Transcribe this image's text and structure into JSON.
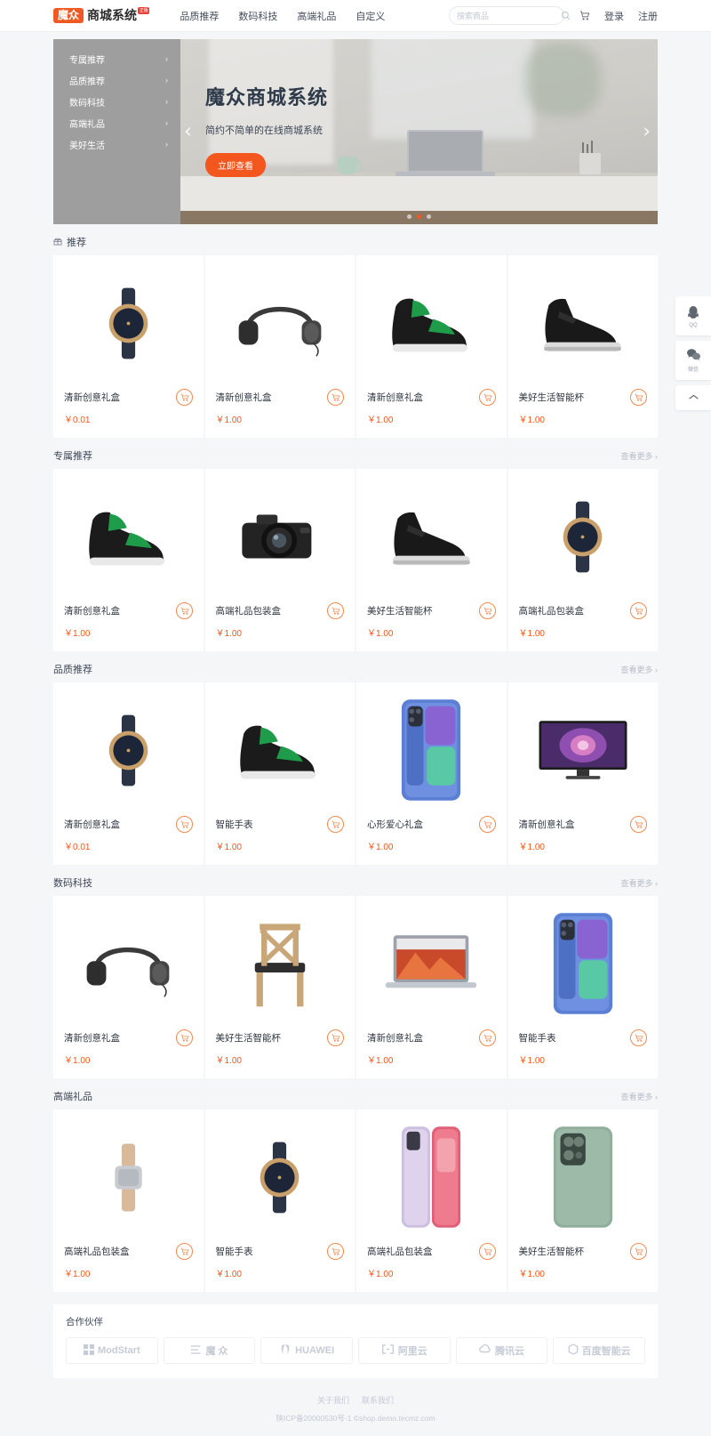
{
  "header": {
    "logo_badge": "魔众",
    "logo_text": "商城系统",
    "logo_tag": "正版",
    "nav": [
      {
        "label": "品质推荐"
      },
      {
        "label": "数码科技"
      },
      {
        "label": "高端礼品"
      },
      {
        "label": "自定义"
      }
    ],
    "search_placeholder": "搜索商品",
    "search_value": "",
    "search_icon": "search-icon",
    "cart_icon": "cart-icon",
    "login": "登录",
    "register": "注册"
  },
  "banner": {
    "categories": [
      {
        "label": "专属推荐"
      },
      {
        "label": "品质推荐"
      },
      {
        "label": "数码科技"
      },
      {
        "label": "高端礼品"
      },
      {
        "label": "美好生活"
      }
    ],
    "title": "魔众商城系统",
    "subtitle": "简约不简单的在线商城系统",
    "button": "立即查看",
    "prev_arrow": "‹",
    "next_arrow": "›",
    "dots": 3,
    "active_dot": 1
  },
  "sections": [
    {
      "title": "推荐",
      "icon": "gift-icon",
      "more": "",
      "products": [
        {
          "name": "清新创意礼盒",
          "price": "￥0.01",
          "image": "wrist-watch"
        },
        {
          "name": "清新创意礼盒",
          "price": "￥1.00",
          "image": "headphones"
        },
        {
          "name": "清新创意礼盒",
          "price": "￥1.00",
          "image": "green-sneaker"
        },
        {
          "name": "美好生活智能杯",
          "price": "￥1.00",
          "image": "black-boot"
        }
      ]
    },
    {
      "title": "专属推荐",
      "icon": "",
      "more": "查看更多",
      "products": [
        {
          "name": "清新创意礼盒",
          "price": "￥1.00",
          "image": "green-sneaker"
        },
        {
          "name": "高端礼品包装盒",
          "price": "￥1.00",
          "image": "camera"
        },
        {
          "name": "美好生活智能杯",
          "price": "￥1.00",
          "image": "black-boot"
        },
        {
          "name": "高端礼品包装盒",
          "price": "￥1.00",
          "image": "wrist-watch"
        }
      ]
    },
    {
      "title": "品质推荐",
      "icon": "",
      "more": "查看更多",
      "products": [
        {
          "name": "清新创意礼盒",
          "price": "￥0.01",
          "image": "wrist-watch"
        },
        {
          "name": "智能手表",
          "price": "￥1.00",
          "image": "green-sneaker"
        },
        {
          "name": "心形爱心礼盒",
          "price": "￥1.00",
          "image": "blue-phone"
        },
        {
          "name": "清新创意礼盒",
          "price": "￥1.00",
          "image": "tv"
        }
      ]
    },
    {
      "title": "数码科技",
      "icon": "",
      "more": "查看更多",
      "products": [
        {
          "name": "清新创意礼盒",
          "price": "￥1.00",
          "image": "headphones"
        },
        {
          "name": "美好生活智能杯",
          "price": "￥1.00",
          "image": "chair"
        },
        {
          "name": "清新创意礼盒",
          "price": "￥1.00",
          "image": "laptop"
        },
        {
          "name": "智能手表",
          "price": "￥1.00",
          "image": "blue-phone"
        }
      ]
    },
    {
      "title": "高端礼品",
      "icon": "",
      "more": "查看更多",
      "products": [
        {
          "name": "高端礼品包装盒",
          "price": "￥1.00",
          "image": "silver-watch"
        },
        {
          "name": "智能手表",
          "price": "￥1.00",
          "image": "wrist-watch"
        },
        {
          "name": "高端礼品包装盒",
          "price": "￥1.00",
          "image": "pink-phone"
        },
        {
          "name": "美好生活智能杯",
          "price": "￥1.00",
          "image": "green-phone"
        }
      ]
    }
  ],
  "partners": {
    "title": "合作伙伴",
    "items": [
      {
        "label": "ModStart",
        "icon": "modstart-icon"
      },
      {
        "label": "魔 众",
        "icon": "mozhong-icon"
      },
      {
        "label": "HUAWEI",
        "icon": "huawei-icon"
      },
      {
        "label": "阿里云",
        "icon": "aliyun-icon"
      },
      {
        "label": "腾讯云",
        "icon": "tencent-icon"
      },
      {
        "label": "百度智能云",
        "icon": "baidu-icon"
      }
    ]
  },
  "footer": {
    "links": [
      {
        "label": "关于我们"
      },
      {
        "label": "联系我们"
      }
    ],
    "copyright": "陕ICP备20000530号-1 ©shop.demo.tecmz.com"
  },
  "float_widget": {
    "qq_label": "QQ",
    "wechat_label": "微信",
    "top_icon": "chevron-up-icon"
  },
  "colors": {
    "accent": "#f4571e",
    "price": "#f4571e",
    "background": "#f5f6f8",
    "card": "#ffffff"
  }
}
